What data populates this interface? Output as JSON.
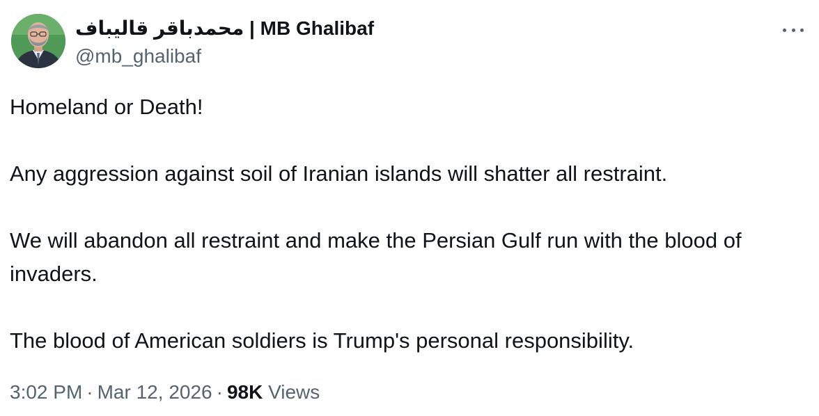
{
  "author": {
    "display_name": "محمدباقر قالیباف | MB Ghalibaf",
    "handle": "@mb_ghalibaf",
    "avatar_icon": "profile-photo"
  },
  "more_icon": "more-horizontal-icon",
  "tweet": {
    "paragraphs": [
      "Homeland or Death!",
      "Any aggression against soil of Iranian islands will shatter all restraint.",
      "We will abandon all restraint and make the Persian Gulf run with the blood of invaders.",
      "The blood of American soldiers is Trump's personal responsibility."
    ]
  },
  "meta": {
    "time": "3:02 PM",
    "separator": "·",
    "date": "Mar 12, 2026",
    "views_count": "98K",
    "views_label": "Views"
  },
  "colors": {
    "text_primary": "#0f1419",
    "text_secondary": "#536471",
    "background": "#ffffff"
  }
}
